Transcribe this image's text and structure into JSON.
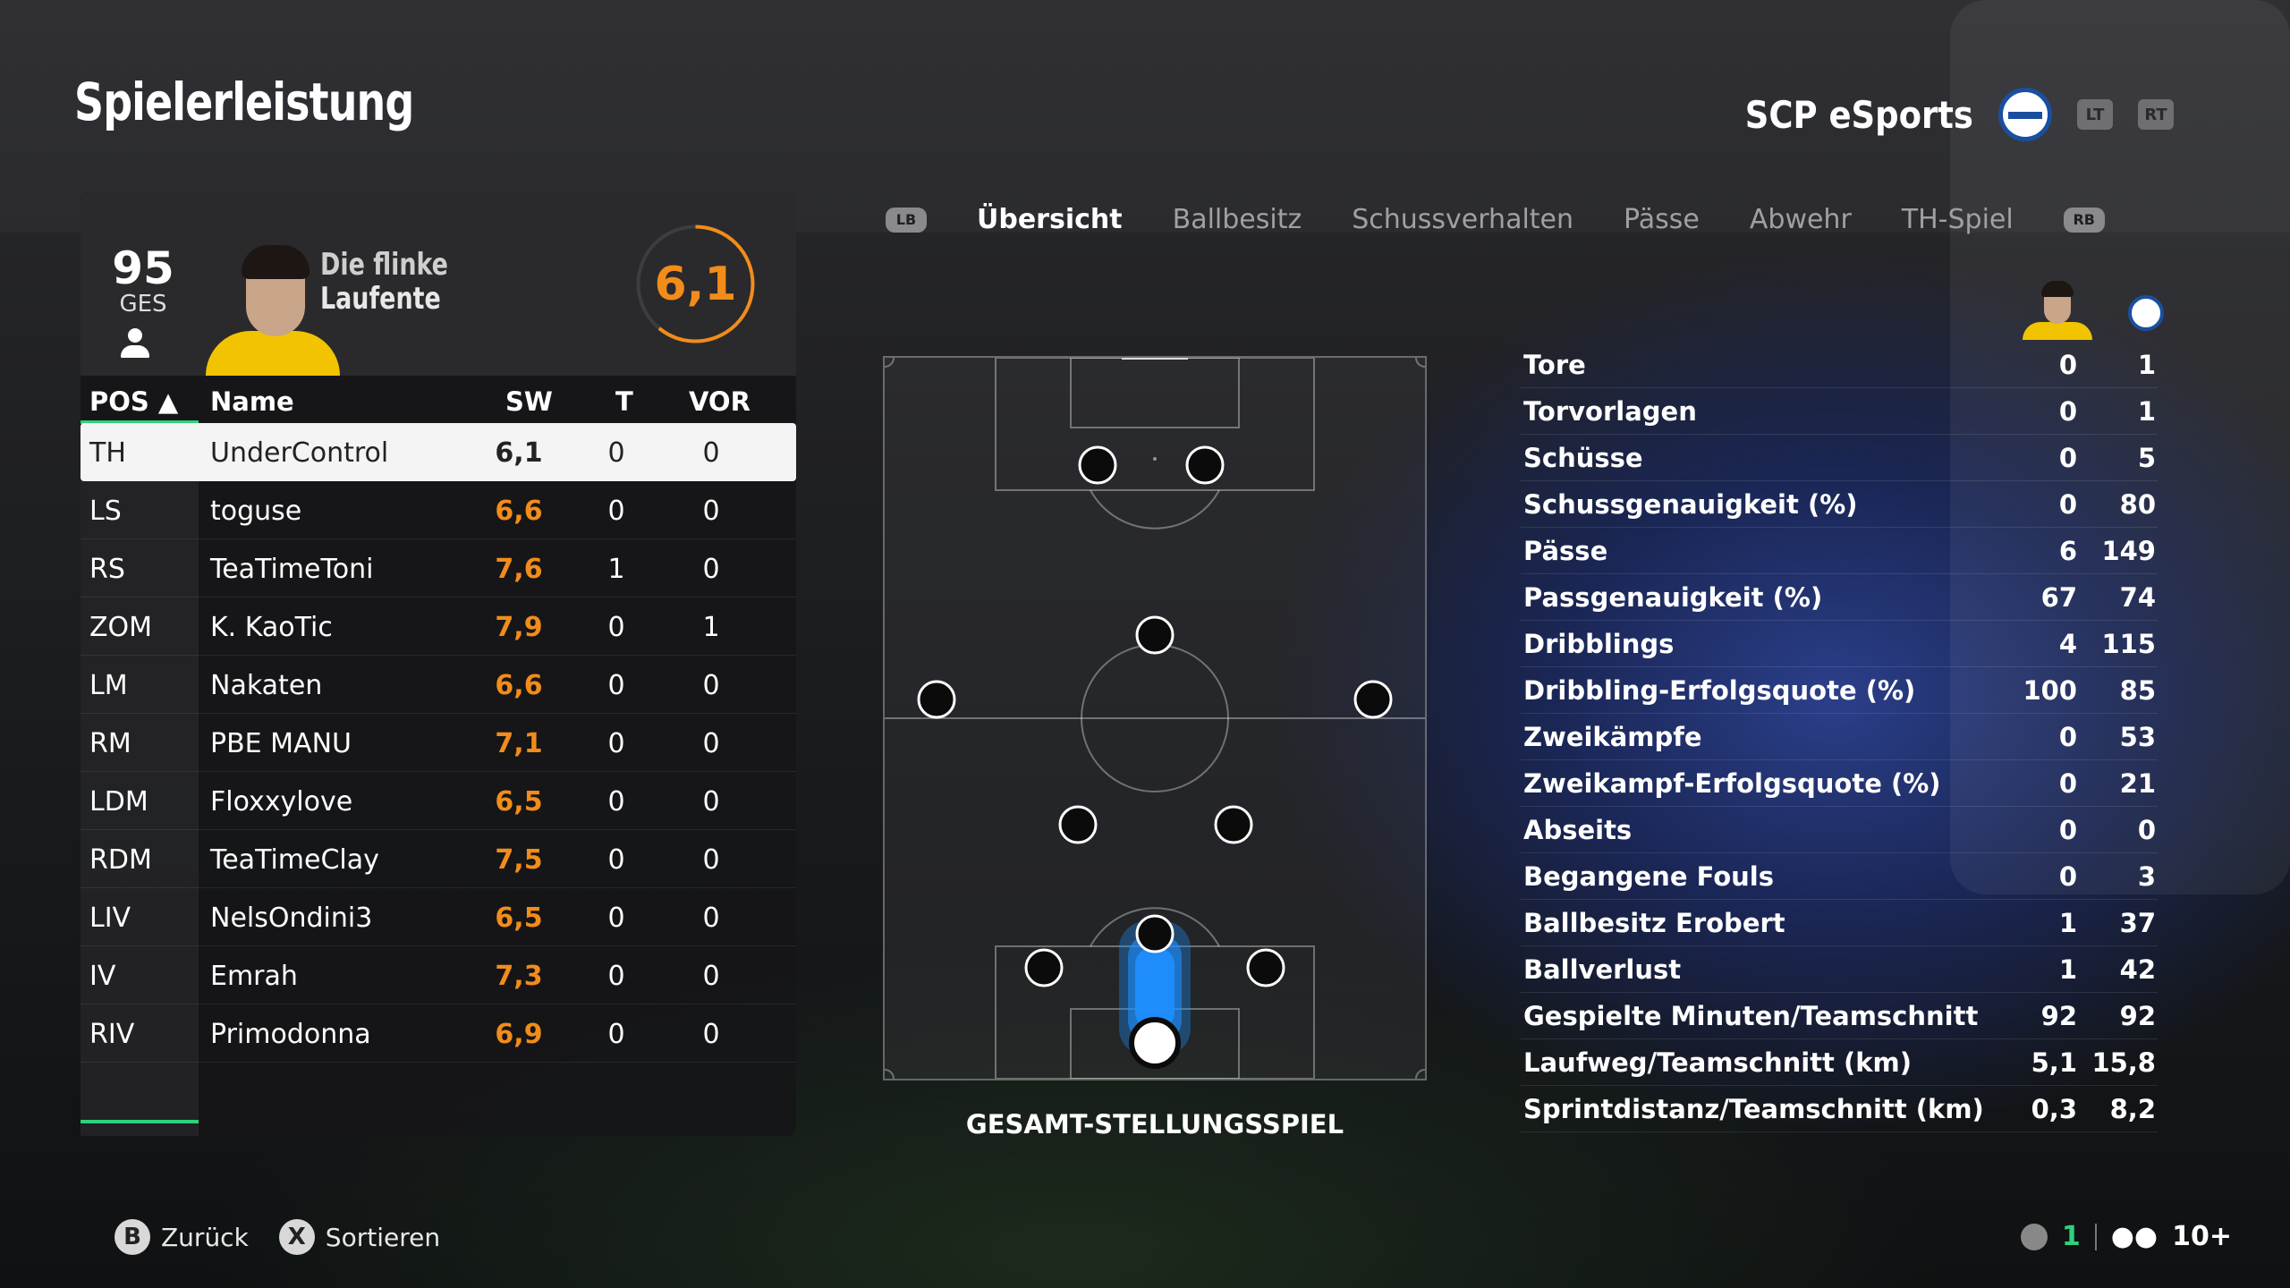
{
  "header": {
    "title": "Spielerleistung",
    "team_name": "SCP eSports",
    "lt": "LT",
    "rt": "RT"
  },
  "player": {
    "overall": "95",
    "overall_label": "GES",
    "playstyle_line1": "Die flinke",
    "playstyle_line2": "Laufente",
    "rating": "6,1"
  },
  "table": {
    "headers": {
      "pos": "POS ▲",
      "name": "Name",
      "sw": "SW",
      "t": "T",
      "vor": "VOR"
    },
    "rows": [
      {
        "pos": "TH",
        "name": "UnderControl",
        "sw": "6,1",
        "t": "0",
        "vor": "0"
      },
      {
        "pos": "LS",
        "name": "toguse",
        "sw": "6,6",
        "t": "0",
        "vor": "0"
      },
      {
        "pos": "RS",
        "name": "TeaTimeToni",
        "sw": "7,6",
        "t": "1",
        "vor": "0"
      },
      {
        "pos": "ZOM",
        "name": "K. KaoTic",
        "sw": "7,9",
        "t": "0",
        "vor": "1"
      },
      {
        "pos": "LM",
        "name": "Nakaten",
        "sw": "6,6",
        "t": "0",
        "vor": "0"
      },
      {
        "pos": "RM",
        "name": "PBE MANU",
        "sw": "7,1",
        "t": "0",
        "vor": "0"
      },
      {
        "pos": "LDM",
        "name": "Floxxylove",
        "sw": "6,5",
        "t": "0",
        "vor": "0"
      },
      {
        "pos": "RDM",
        "name": "TeaTimeClay",
        "sw": "7,5",
        "t": "0",
        "vor": "0"
      },
      {
        "pos": "LIV",
        "name": "NelsOndini3",
        "sw": "6,5",
        "t": "0",
        "vor": "0"
      },
      {
        "pos": "IV",
        "name": "Emrah",
        "sw": "7,3",
        "t": "0",
        "vor": "0"
      },
      {
        "pos": "RIV",
        "name": "Primodonna",
        "sw": "6,9",
        "t": "0",
        "vor": "0"
      }
    ]
  },
  "tabs": {
    "lb": "LB",
    "rb": "RB",
    "items": [
      "Übersicht",
      "Ballbesitz",
      "Schussverhalten",
      "Pässe",
      "Abwehr",
      "TH-Spiel"
    ]
  },
  "pitch": {
    "label": "GESAMT-STELLUNGSSPIEL"
  },
  "stats": [
    {
      "label": "Tore",
      "player": "0",
      "team": "1"
    },
    {
      "label": "Torvorlagen",
      "player": "0",
      "team": "1"
    },
    {
      "label": "Schüsse",
      "player": "0",
      "team": "5"
    },
    {
      "label": "Schussgenauigkeit (%)",
      "player": "0",
      "team": "80"
    },
    {
      "label": "Pässe",
      "player": "6",
      "team": "149"
    },
    {
      "label": "Passgenauigkeit (%)",
      "player": "67",
      "team": "74"
    },
    {
      "label": "Dribblings",
      "player": "4",
      "team": "115"
    },
    {
      "label": "Dribbling-Erfolgsquote (%)",
      "player": "100",
      "team": "85"
    },
    {
      "label": "Zweikämpfe",
      "player": "0",
      "team": "53"
    },
    {
      "label": "Zweikampf-Erfolgsquote (%)",
      "player": "0",
      "team": "21"
    },
    {
      "label": "Abseits",
      "player": "0",
      "team": "0"
    },
    {
      "label": "Begangene Fouls",
      "player": "0",
      "team": "3"
    },
    {
      "label": "Ballbesitz Erobert",
      "player": "1",
      "team": "37"
    },
    {
      "label": "Ballverlust",
      "player": "1",
      "team": "42"
    },
    {
      "label": "Gespielte Minuten/Teamschnitt",
      "player": "92",
      "team": "92"
    },
    {
      "label": "Laufweg/Teamschnitt (km)",
      "player": "5,1",
      "team": "15,8"
    },
    {
      "label": "Sprintdistanz/Teamschnitt (km)",
      "player": "0,3",
      "team": "8,2"
    }
  ],
  "footer": {
    "back_key": "B",
    "back": "Zurück",
    "sort_key": "X",
    "sort": "Sortieren",
    "mic_count": "1",
    "party": "10+"
  },
  "colors": {
    "rating": "#f28c1a",
    "accent": "#2fd17a",
    "heat": "#1e8fff"
  }
}
